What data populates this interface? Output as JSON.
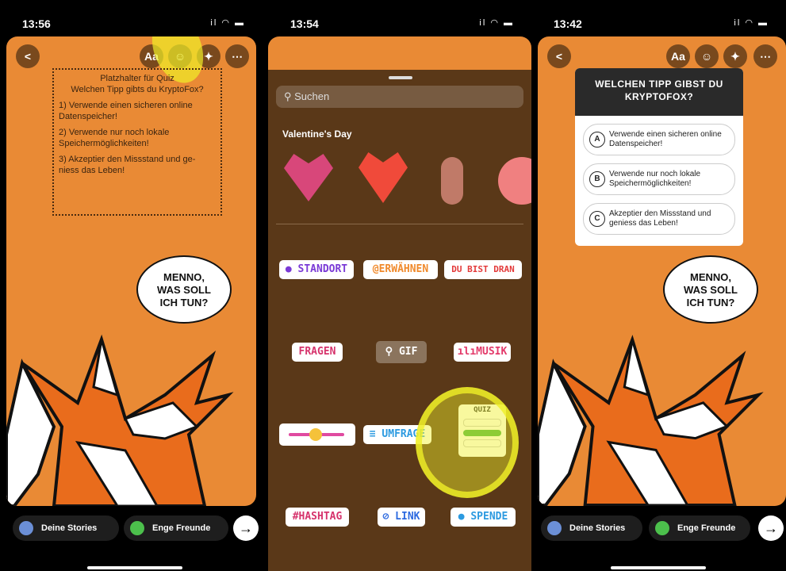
{
  "panel1": {
    "time": "13:56",
    "status_icons": "il ◠ ▬",
    "top_buttons": {
      "back": "<",
      "text": "Aa",
      "sticker": "☺",
      "effects": "✦",
      "more": "⋯"
    },
    "quiz_placeholder": {
      "title": "Platzhalter für Quiz",
      "question": "Welchen Tipp gibts du KryptoFox?",
      "items": [
        "1) Verwende einen sicheren online Datenspeicher!",
        "2) Verwende nur noch lokale Speichermöglichkeiten!",
        "3) Akzeptier den Missstand und ge-niess das Leben!"
      ]
    },
    "bubble": [
      "MENNO,",
      "WAS SOLL",
      "ICH TUN?"
    ],
    "bottom": {
      "stories": "Deine Stories",
      "friends": "Enge Freunde",
      "next": "→"
    }
  },
  "panel2": {
    "time": "13:54",
    "status_icons": "il ◠ ▬",
    "search_placeholder": "Suchen",
    "section_title": "Valentine's Day",
    "stickers": {
      "location": "STANDORT",
      "mention": "@ERWÄHNEN",
      "your_turn": "DU BIST DRAN",
      "questions": "FRAGEN",
      "gif": "GIF",
      "music": "MUSIK",
      "poll": "UMFRAGE",
      "quiz": "QUIZ",
      "hashtag": "#HASHTAG",
      "link": "LINK",
      "donate": "SPENDE"
    }
  },
  "panel3": {
    "time": "13:42",
    "status_icons": "il ◠ ▬",
    "top_buttons": {
      "back": "<",
      "text": "Aa",
      "sticker": "☺",
      "effects": "✦",
      "more": "⋯"
    },
    "quiz": {
      "title_line1": "WELCHEN TIPP GIBST DU",
      "title_line2": "KRYPTOFOX?",
      "options": [
        {
          "letter": "A",
          "text": "Verwende einen sicheren online Datenspeicher!"
        },
        {
          "letter": "B",
          "text": "Verwende nur noch lokale Speichermöglichkeiten!"
        },
        {
          "letter": "C",
          "text": "Akzeptier den Missstand und geniess das Leben!"
        }
      ]
    },
    "bubble": [
      "MENNO,",
      "WAS SOLL",
      "ICH TUN?"
    ],
    "bottom": {
      "stories": "Deine Stories",
      "friends": "Enge Freunde",
      "next": "→"
    }
  },
  "colors": {
    "story_bg": "#e98a35",
    "highlight": "#f0f028",
    "tray_bg": "#5a3818"
  }
}
